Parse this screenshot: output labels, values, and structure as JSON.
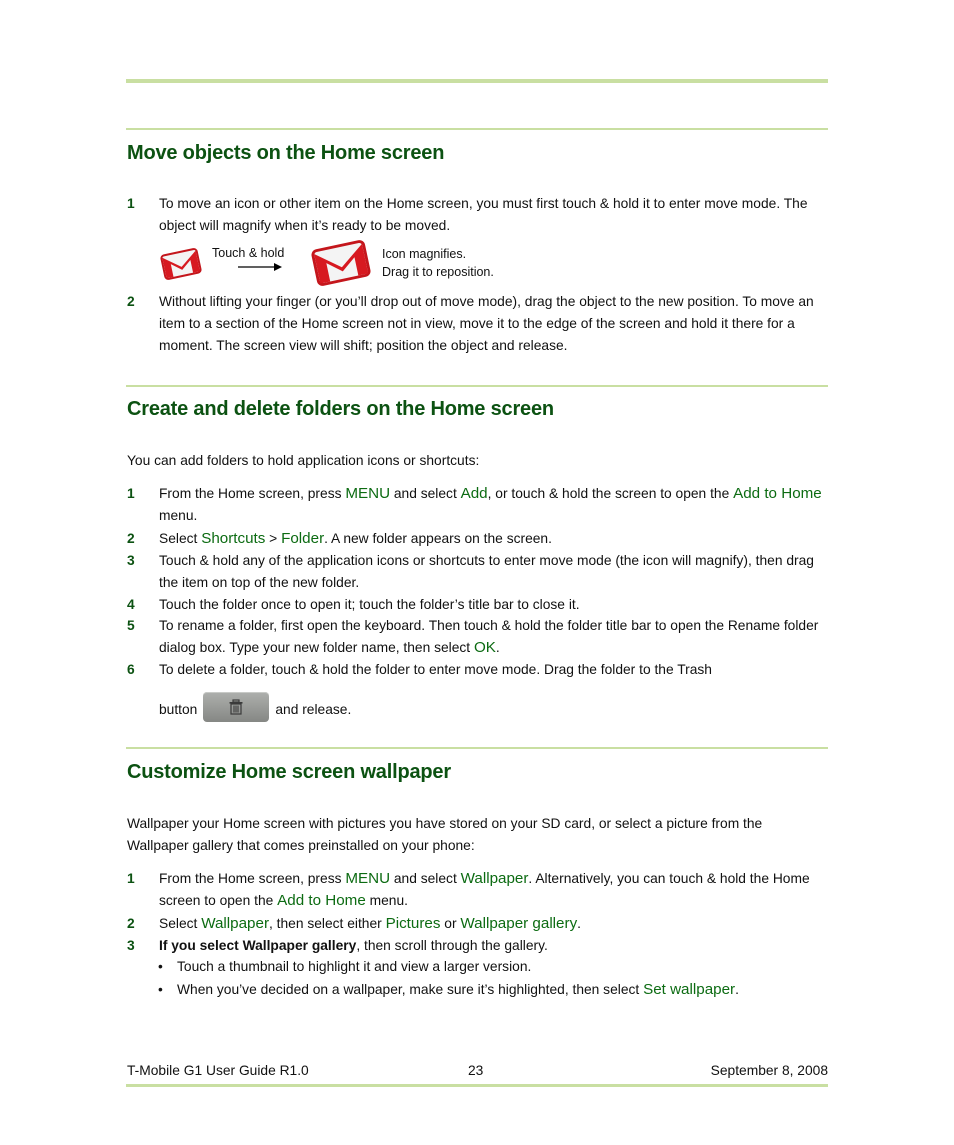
{
  "sections": [
    {
      "title": "Move objects on the Home screen",
      "steps": [
        {
          "num": "1",
          "text": "To move an icon or other item on the Home screen, you must first touch & hold it to enter move mode. The object will magnify when it’s ready to be moved."
        },
        {
          "num": "2",
          "text": "Without lifting your finger (or you’ll drop out of move mode), drag the object to the new position. To move an item to a section of the Home screen not in view, move it to the edge of the screen and hold it there for a moment. The screen view will shift; position the object and release."
        }
      ],
      "figure": {
        "action_label": "Touch & hold",
        "result_line1": "Icon magnifies.",
        "result_line2": "Drag it to reposition.",
        "icon": "gmail-icon"
      }
    },
    {
      "title": "Create and delete folders on the Home screen",
      "intro": "You can add folders to hold application icons or shortcuts:",
      "steps": [
        {
          "num": "1",
          "parts": [
            "From the Home screen, press ",
            "MENU",
            " and select ",
            "Add",
            ", or touch & hold the screen to open the ",
            "Add to Home",
            " menu."
          ]
        },
        {
          "num": "2",
          "parts": [
            "Select ",
            "Shortcuts",
            " > ",
            "Folder",
            ". A new folder appears on the screen."
          ]
        },
        {
          "num": "3",
          "text": "Touch & hold any of the application icons or shortcuts to enter move mode (the icon will magnify), then drag the item on top of the new folder."
        },
        {
          "num": "4",
          "text": "Touch the folder once to open it; touch the folder’s title bar to close it."
        },
        {
          "num": "5",
          "parts": [
            "To rename a folder, first open the keyboard. Then touch & hold the folder title bar to open the Rename folder dialog box. Type your new folder name, then select ",
            "OK",
            "."
          ]
        },
        {
          "num": "6",
          "parts": [
            "To delete a folder, touch & hold the folder to enter move mode. Drag the folder to the Trash",
            "button",
            "and release."
          ]
        }
      ]
    },
    {
      "title": "Customize Home screen wallpaper",
      "intro": "Wallpaper your Home screen with pictures you have stored on your SD card, or select a picture from the Wallpaper gallery that comes preinstalled on your phone:",
      "steps": [
        {
          "num": "1",
          "parts": [
            "From the Home screen, press ",
            "MENU",
            " and select ",
            "Wallpaper",
            ". Alternatively, you can touch & hold the Home screen to open the ",
            "Add to Home",
            " menu."
          ]
        },
        {
          "num": "2",
          "parts": [
            "Select ",
            "Wallpaper",
            ", then select either ",
            "Pictures",
            " or ",
            "Wallpaper gallery",
            "."
          ]
        },
        {
          "num": "3",
          "parts": [
            "If you select Wallpaper gallery",
            ", then scroll through the gallery."
          ]
        }
      ],
      "bullets": [
        {
          "parts": [
            "Touch a thumbnail to highlight it and view a larger version."
          ]
        },
        {
          "parts": [
            "When you’ve decided on a wallpaper, make sure it’s highlighted, then select ",
            "Set wallpaper",
            "."
          ]
        }
      ],
      "bullet_glyph": "•"
    }
  ],
  "footer": {
    "left": "T-Mobile G1 User Guide R1.0",
    "page": "23",
    "date": "September 8, 2008"
  },
  "colors": {
    "heading": "#0c5212",
    "ui_term": "#0c6b12",
    "rule": "#c9dfa2"
  }
}
